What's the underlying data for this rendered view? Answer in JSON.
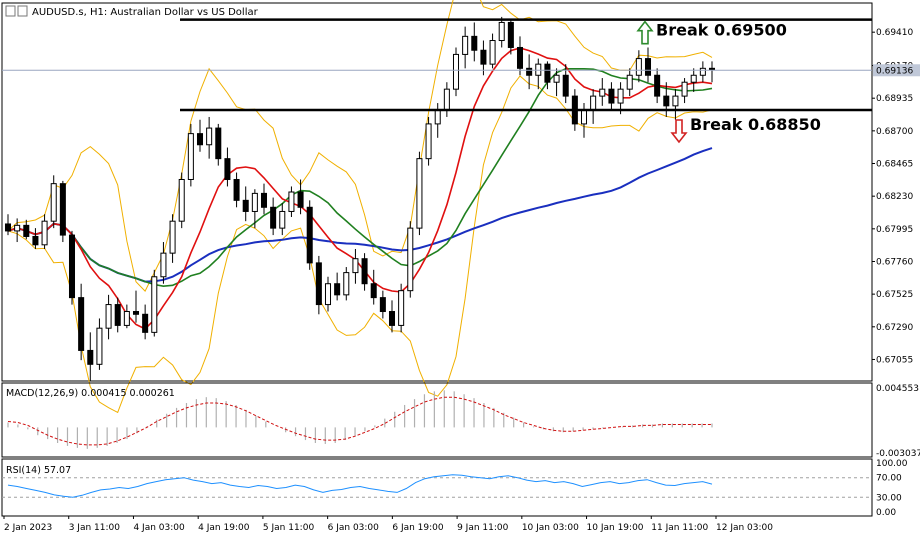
{
  "header": {
    "symbol_info": "AUDUSD.s, H1:  Australian Dollar vs US Dollar"
  },
  "chart_data": [
    {
      "type": "candlestick",
      "panel": "price",
      "y_ticks": [
        "0.69410",
        "0.69170",
        "0.68935",
        "0.68700",
        "0.68465",
        "0.68230",
        "0.67995",
        "0.67760",
        "0.67525",
        "0.67290",
        "0.67055"
      ],
      "ylim": [
        0.669,
        0.6962
      ],
      "current_price_label": "0.69136",
      "current_price": 0.69136,
      "annotations": [
        {
          "text": "Break 0.69500",
          "level": 0.695,
          "arrow": "up",
          "color": "#2e8b2e"
        },
        {
          "text": "Break 0.68850",
          "level": 0.6885,
          "arrow": "down",
          "color": "#d22222"
        }
      ],
      "levels": [
        0.695,
        0.6885
      ],
      "overlays": [
        {
          "name": "bollinger",
          "color": "#f0b000"
        },
        {
          "name": "ma_fast",
          "color": "#e01010"
        },
        {
          "name": "ma_mid",
          "color": "#208020"
        },
        {
          "name": "ma_slow",
          "color": "#1a2fbf"
        }
      ],
      "candles": [
        [
          0.6803,
          0.681,
          0.6795,
          0.6798
        ],
        [
          0.6798,
          0.6807,
          0.679,
          0.6802
        ],
        [
          0.6802,
          0.6806,
          0.6792,
          0.6794
        ],
        [
          0.6794,
          0.68,
          0.6785,
          0.6788
        ],
        [
          0.6788,
          0.681,
          0.6785,
          0.6805
        ],
        [
          0.6805,
          0.6838,
          0.68,
          0.6832
        ],
        [
          0.6832,
          0.6834,
          0.679,
          0.6795
        ],
        [
          0.6795,
          0.6798,
          0.6745,
          0.675
        ],
        [
          0.675,
          0.676,
          0.6705,
          0.6712
        ],
        [
          0.6712,
          0.6725,
          0.669,
          0.6702
        ],
        [
          0.6702,
          0.6735,
          0.6698,
          0.6728
        ],
        [
          0.6728,
          0.6752,
          0.672,
          0.6745
        ],
        [
          0.6745,
          0.675,
          0.6725,
          0.673
        ],
        [
          0.673,
          0.6745,
          0.6728,
          0.674
        ],
        [
          0.674,
          0.6755,
          0.6732,
          0.6738
        ],
        [
          0.6738,
          0.6745,
          0.672,
          0.6725
        ],
        [
          0.6725,
          0.677,
          0.6722,
          0.6765
        ],
        [
          0.6765,
          0.679,
          0.676,
          0.6782
        ],
        [
          0.6782,
          0.681,
          0.6775,
          0.6805
        ],
        [
          0.6805,
          0.684,
          0.68,
          0.6835
        ],
        [
          0.6835,
          0.6875,
          0.683,
          0.6868
        ],
        [
          0.6868,
          0.6878,
          0.6855,
          0.686
        ],
        [
          0.686,
          0.688,
          0.685,
          0.6872
        ],
        [
          0.6872,
          0.6875,
          0.6845,
          0.685
        ],
        [
          0.685,
          0.6858,
          0.683,
          0.6835
        ],
        [
          0.6835,
          0.684,
          0.6815,
          0.682
        ],
        [
          0.682,
          0.683,
          0.6805,
          0.6812
        ],
        [
          0.6812,
          0.6828,
          0.68,
          0.6825
        ],
        [
          0.6825,
          0.6832,
          0.681,
          0.6815
        ],
        [
          0.6815,
          0.6822,
          0.6795,
          0.68
        ],
        [
          0.68,
          0.6818,
          0.6795,
          0.6812
        ],
        [
          0.6812,
          0.683,
          0.6808,
          0.6826
        ],
        [
          0.6826,
          0.6835,
          0.681,
          0.6815
        ],
        [
          0.6815,
          0.682,
          0.677,
          0.6775
        ],
        [
          0.6775,
          0.678,
          0.6738,
          0.6745
        ],
        [
          0.6745,
          0.6765,
          0.674,
          0.676
        ],
        [
          0.676,
          0.6768,
          0.6748,
          0.6752
        ],
        [
          0.6752,
          0.6772,
          0.6748,
          0.6768
        ],
        [
          0.6768,
          0.6785,
          0.676,
          0.6778
        ],
        [
          0.6778,
          0.6782,
          0.6755,
          0.676
        ],
        [
          0.676,
          0.677,
          0.6745,
          0.675
        ],
        [
          0.675,
          0.6755,
          0.6735,
          0.674
        ],
        [
          0.674,
          0.6748,
          0.6725,
          0.673
        ],
        [
          0.673,
          0.676,
          0.6725,
          0.6755
        ],
        [
          0.6755,
          0.6805,
          0.675,
          0.68
        ],
        [
          0.68,
          0.6855,
          0.6795,
          0.685
        ],
        [
          0.685,
          0.688,
          0.6845,
          0.6875
        ],
        [
          0.6875,
          0.689,
          0.6865,
          0.6885
        ],
        [
          0.6885,
          0.6905,
          0.688,
          0.69
        ],
        [
          0.69,
          0.693,
          0.6895,
          0.6925
        ],
        [
          0.6925,
          0.6945,
          0.6915,
          0.6938
        ],
        [
          0.6938,
          0.6948,
          0.692,
          0.6928
        ],
        [
          0.6928,
          0.6935,
          0.691,
          0.6918
        ],
        [
          0.6918,
          0.694,
          0.6915,
          0.6935
        ],
        [
          0.6935,
          0.6952,
          0.693,
          0.6948
        ],
        [
          0.6948,
          0.695,
          0.6925,
          0.693
        ],
        [
          0.693,
          0.6938,
          0.691,
          0.6915
        ],
        [
          0.6915,
          0.6925,
          0.69,
          0.691
        ],
        [
          0.691,
          0.6922,
          0.69,
          0.6918
        ],
        [
          0.6918,
          0.692,
          0.69,
          0.6905
        ],
        [
          0.6905,
          0.6915,
          0.6895,
          0.691
        ],
        [
          0.691,
          0.6918,
          0.689,
          0.6895
        ],
        [
          0.6895,
          0.69,
          0.687,
          0.6875
        ],
        [
          0.6875,
          0.689,
          0.6865,
          0.6885
        ],
        [
          0.6885,
          0.69,
          0.6875,
          0.6895
        ],
        [
          0.6895,
          0.6908,
          0.6888,
          0.69
        ],
        [
          0.69,
          0.6905,
          0.6885,
          0.689
        ],
        [
          0.689,
          0.6905,
          0.6882,
          0.69
        ],
        [
          0.69,
          0.6915,
          0.6895,
          0.691
        ],
        [
          0.691,
          0.6928,
          0.6905,
          0.6922
        ],
        [
          0.6922,
          0.693,
          0.6905,
          0.691
        ],
        [
          0.691,
          0.6915,
          0.689,
          0.6895
        ],
        [
          0.6895,
          0.6905,
          0.688,
          0.6888
        ],
        [
          0.6888,
          0.69,
          0.6878,
          0.6895
        ],
        [
          0.6895,
          0.6908,
          0.689,
          0.6905
        ],
        [
          0.6905,
          0.6915,
          0.6898,
          0.691
        ],
        [
          0.691,
          0.692,
          0.6905,
          0.6915
        ],
        [
          0.6915,
          0.692,
          0.6905,
          0.6914
        ]
      ]
    },
    {
      "type": "macd",
      "panel": "macd",
      "label": "MACD(12,26,9) 0.000415 0.000261",
      "y_ticks": [
        "0.004553",
        "-0.003037"
      ],
      "ylim": [
        -0.003037,
        0.004553
      ],
      "histogram": [
        0.0005,
        0.0003,
        -0.0002,
        -0.0008,
        -0.0012,
        -0.0016,
        -0.0019,
        -0.0021,
        -0.0022,
        -0.0021,
        -0.0019,
        -0.0016,
        -0.0012,
        -0.0006,
        0.0001,
        0.0008,
        0.0014,
        0.002,
        0.0025,
        0.0029,
        0.0031,
        0.003,
        0.0027,
        0.0023,
        0.0018,
        0.0012,
        0.0006,
        0.0,
        -0.0005,
        -0.0009,
        -0.0013,
        -0.0016,
        -0.0017,
        -0.0016,
        -0.0013,
        -0.0009,
        -0.0004,
        0.0002,
        0.0009,
        0.0016,
        0.0023,
        0.0029,
        0.0034,
        0.0037,
        0.0038,
        0.0037,
        0.0034,
        0.003,
        0.0025,
        0.002,
        0.0015,
        0.001,
        0.0005,
        0.0001,
        -0.0002,
        -0.0004,
        -0.0005,
        -0.0004,
        -0.0003,
        -0.0002,
        -0.0001,
        0.0,
        0.0001,
        0.0002,
        0.0003,
        0.0003,
        0.0004,
        0.0004,
        0.0004,
        0.0004,
        0.0004,
        0.0004
      ],
      "signal": [
        0.0006,
        0.0005,
        0.0002,
        -0.0003,
        -0.0008,
        -0.0012,
        -0.0015,
        -0.0017,
        -0.0018,
        -0.0018,
        -0.0017,
        -0.0014,
        -0.001,
        -0.0005,
        0.0,
        0.0006,
        0.0011,
        0.0016,
        0.002,
        0.0023,
        0.0025,
        0.0025,
        0.0024,
        0.0021,
        0.0017,
        0.0012,
        0.0007,
        0.0002,
        -0.0002,
        -0.0006,
        -0.0009,
        -0.0012,
        -0.0013,
        -0.0013,
        -0.0012,
        -0.0009,
        -0.0005,
        -0.0001,
        0.0004,
        0.001,
        0.0016,
        0.0021,
        0.0026,
        0.0029,
        0.0031,
        0.0031,
        0.0029,
        0.0026,
        0.0022,
        0.0018,
        0.0013,
        0.0009,
        0.0005,
        0.0002,
        -0.0001,
        -0.0003,
        -0.0004,
        -0.0004,
        -0.0003,
        -0.0002,
        -0.0001,
        0.0,
        0.0001,
        0.0001,
        0.0002,
        0.0002,
        0.0003,
        0.0003,
        0.0003,
        0.0003,
        0.0003,
        0.0003
      ]
    },
    {
      "type": "line",
      "panel": "rsi",
      "label": "RSI(14) 57.07",
      "y_ticks": [
        "100.00",
        "70.00",
        "30.00",
        "0.00"
      ],
      "ylim": [
        0,
        100
      ],
      "levels": [
        70,
        30
      ],
      "values": [
        55,
        52,
        48,
        44,
        40,
        35,
        32,
        30,
        34,
        40,
        45,
        47,
        50,
        48,
        52,
        58,
        62,
        66,
        68,
        70,
        65,
        62,
        58,
        60,
        55,
        52,
        50,
        54,
        52,
        48,
        50,
        55,
        52,
        45,
        40,
        44,
        46,
        50,
        52,
        48,
        45,
        42,
        40,
        48,
        60,
        68,
        72,
        74,
        76,
        75,
        72,
        70,
        68,
        72,
        74,
        70,
        65,
        62,
        64,
        60,
        62,
        58,
        52,
        56,
        60,
        62,
        58,
        60,
        64,
        66,
        60,
        55,
        54,
        58,
        60,
        62,
        57
      ]
    }
  ],
  "x_labels": [
    "2 Jan 2023",
    "3 Jan 11:00",
    "4 Jan 03:00",
    "4 Jan 19:00",
    "5 Jan 11:00",
    "6 Jan 03:00",
    "6 Jan 19:00",
    "9 Jan 11:00",
    "10 Jan 03:00",
    "10 Jan 19:00",
    "11 Jan 11:00",
    "12 Jan 03:00"
  ],
  "colors": {
    "candle_up": "#000000",
    "candle_down": "#000000",
    "grid_border": "#000000",
    "price_label_bg": "#c0c8d8",
    "macd_hist": "#b0b0b0",
    "macd_signal": "#d01010",
    "rsi_line": "#1e90ff"
  }
}
